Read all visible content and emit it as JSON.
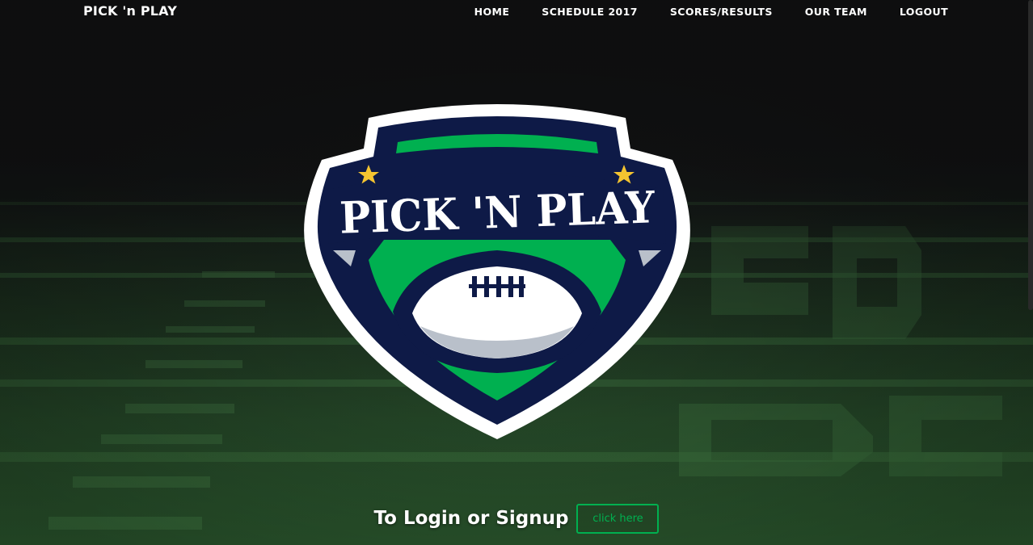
{
  "navbar": {
    "brand": "PICK 'n PLAY",
    "links": [
      "HOME",
      "SCHEDULE 2017",
      "SCORES/RESULTS",
      "OUR TEAM",
      "LOGOUT"
    ]
  },
  "logo": {
    "text": "PICK 'N PLAY"
  },
  "cta": {
    "text": "To Login or Signup",
    "button_label": "click here"
  },
  "colors": {
    "navy": "#0e1a47",
    "green": "#00b050",
    "white": "#ffffff",
    "star": "#f4c430",
    "ball_shadow": "#b9c0ca",
    "background": "#121314",
    "grass": "#2c5a2f"
  },
  "icons": {
    "stars": "star-icon",
    "football": "football-icon"
  }
}
